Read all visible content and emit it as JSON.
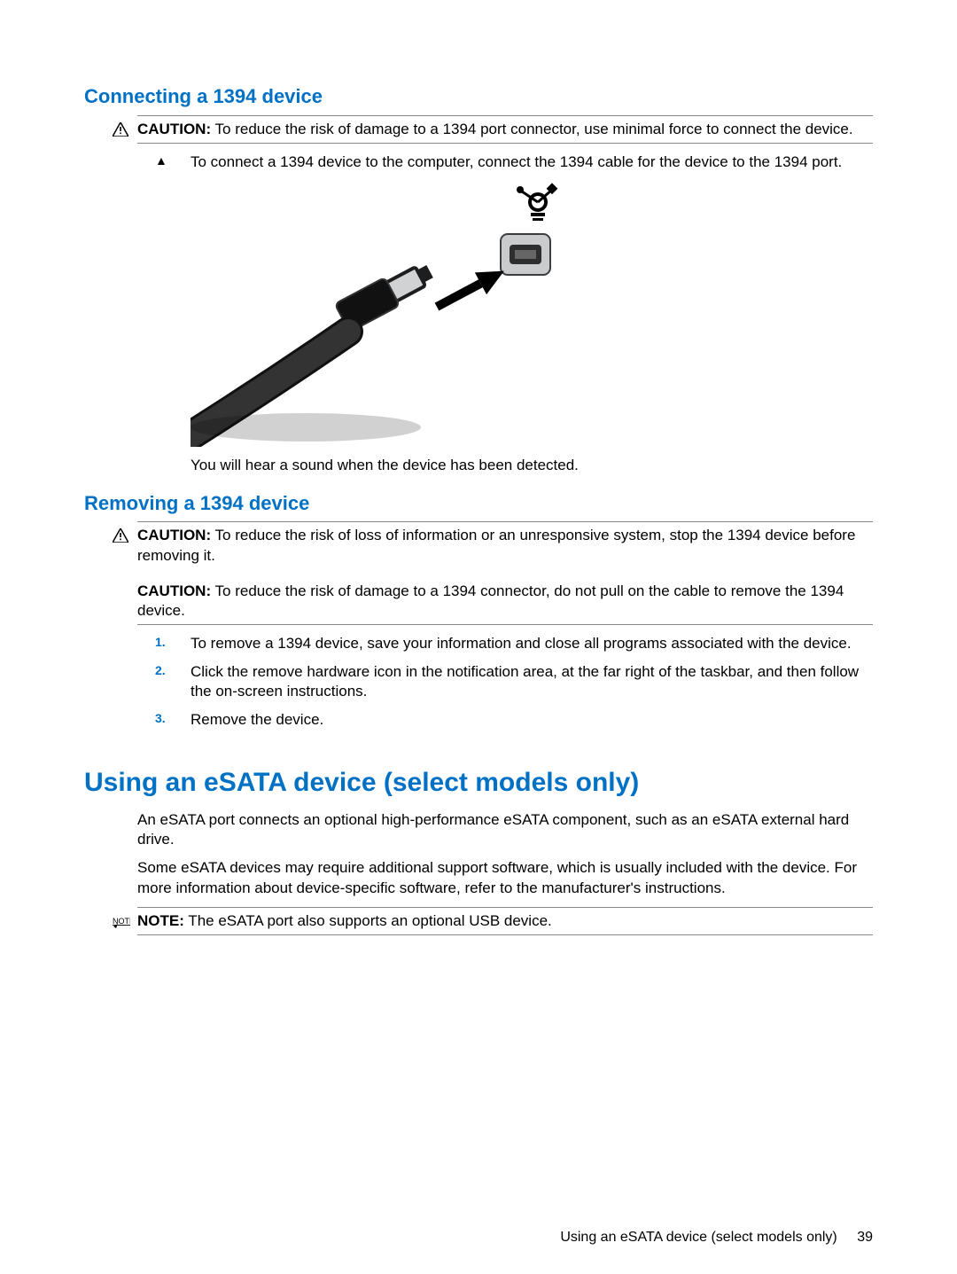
{
  "sections": {
    "connecting": {
      "title": "Connecting a 1394 device",
      "caution_label": "CAUTION:",
      "caution_text": "To reduce the risk of damage to a 1394 port connector, use minimal force to connect the device.",
      "step_text": "To connect a 1394 device to the computer, connect the 1394 cable for the device to the 1394 port.",
      "post_figure": "You will hear a sound when the device has been detected."
    },
    "removing": {
      "title": "Removing a 1394 device",
      "caution1_label": "CAUTION:",
      "caution1_text": "To reduce the risk of loss of information or an unresponsive system, stop the 1394 device before removing it.",
      "caution2_label": "CAUTION:",
      "caution2_text": "To reduce the risk of damage to a 1394 connector, do not pull on the cable to remove the 1394 device.",
      "steps": [
        {
          "num": "1.",
          "text": "To remove a 1394 device, save your information and close all programs associated with the device."
        },
        {
          "num": "2.",
          "text": "Click the remove hardware icon in the notification area, at the far right of the taskbar, and then follow the on-screen instructions."
        },
        {
          "num": "3.",
          "text": "Remove the device."
        }
      ]
    },
    "esata": {
      "title": "Using an eSATA device (select models only)",
      "p1": "An eSATA port connects an optional high-performance eSATA component, such as an eSATA external hard drive.",
      "p2": "Some eSATA devices may require additional support software, which is usually included with the device. For more information about device-specific software, refer to the manufacturer's instructions.",
      "note_label": "NOTE:",
      "note_text": "The eSATA port also supports an optional USB device."
    }
  },
  "footer": {
    "text": "Using an eSATA device (select models only)",
    "page": "39"
  },
  "icons": {
    "caution": "caution-icon",
    "note": "note-icon",
    "triangle": "▲"
  }
}
